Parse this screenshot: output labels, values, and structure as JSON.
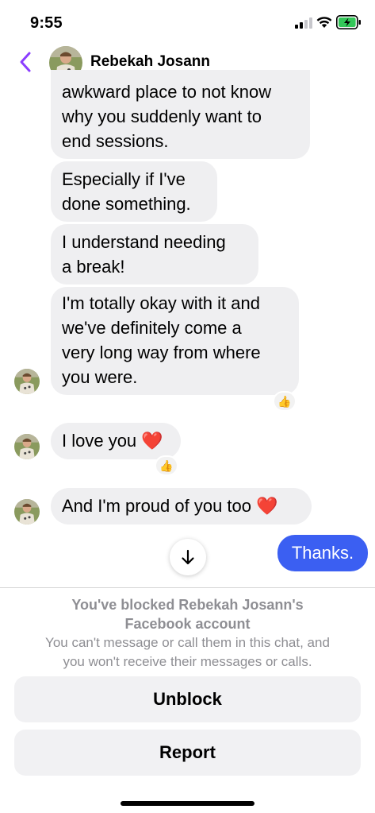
{
  "status_bar": {
    "time": "9:55"
  },
  "header": {
    "name": "Rebekah Josann"
  },
  "messages": [
    {
      "text": "awkward place to not know\nwhy you suddenly want to\nend sessions."
    },
    {
      "text": "Especially if I've\ndone something."
    },
    {
      "text": "I understand needing\na break!"
    },
    {
      "text": "I'm totally okay with it and\nwe've definitely come a\nvery long way from where\nyou were.",
      "reaction": "👍"
    },
    {
      "text": "I love you ❤️",
      "reaction": "👍"
    },
    {
      "text": "And I'm proud of you too ❤️"
    }
  ],
  "sent_message": {
    "text": "Thanks."
  },
  "blocked_notice": {
    "title": "You've blocked Rebekah Josann's\nFacebook account",
    "description": "You can't message or call them in this chat, and\nyou won't receive their messages or calls."
  },
  "buttons": {
    "unblock": "Unblock",
    "report": "Report"
  },
  "colors": {
    "accent": "#3b5ff2",
    "back_arrow": "#8b3dff",
    "bubble": "#efeff1"
  }
}
